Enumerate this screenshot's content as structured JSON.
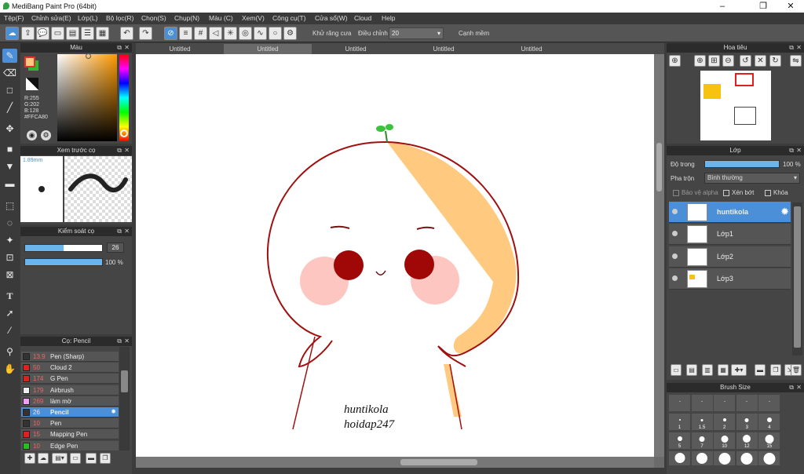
{
  "titlebar": {
    "title": "MediBang Paint Pro (64bit)",
    "minimize": "–",
    "maximize": "❐",
    "close": "✕"
  },
  "menu": [
    "Tệp(F)",
    "Chỉnh sửa(E)",
    "Lớp(L)",
    "Bộ lọc(R)",
    "Chọn(S)",
    "Chụp(N)",
    "Màu (C)",
    "Xem(V)",
    "Công cụ(T)",
    "Cửa sổ(W)",
    "Cloud",
    "Help"
  ],
  "toolbar": {
    "antialias_label": "Khử răng cưa",
    "adjust_label": "Điều chỉnh",
    "adjust_value": "20",
    "snap_label": "Cạnh mềm"
  },
  "colors": {
    "accent": "#4a8fd8",
    "primary": "#FFCA80",
    "secondary": "#2fb82f"
  },
  "color_panel": {
    "title": "Màu",
    "r": "R:255",
    "g": "G:202",
    "b": "B:128",
    "hex": "#FFCA80"
  },
  "brush_preview": {
    "title": "Xem trước cọ",
    "size": "1.89mm"
  },
  "brush_control": {
    "title": "Kiểm soát cọ",
    "size": "26",
    "opacity": "100 %",
    "size_fraction": 0.5,
    "opacity_fraction": 1.0
  },
  "brush_panel": {
    "title": "Cọ: Pencil",
    "items": [
      {
        "size": "13.9",
        "name": "Pen (Sharp)",
        "color": "#333333"
      },
      {
        "size": "50",
        "name": "Cloud 2",
        "color": "#e02020"
      },
      {
        "size": "174",
        "name": "G Pen",
        "color": "#e02020"
      },
      {
        "size": "179",
        "name": "Airbrush",
        "color": "#f0f0f0"
      },
      {
        "size": "269",
        "name": "làm mờ",
        "color": "#f0a0f0"
      },
      {
        "size": "26",
        "name": "Pencil",
        "color": "#333333",
        "selected": true
      },
      {
        "size": "10",
        "name": "Pen",
        "color": "#333333"
      },
      {
        "size": "15",
        "name": "Mapping Pen",
        "color": "#e02020"
      },
      {
        "size": "10",
        "name": "Edge Pen",
        "color": "#20c020"
      }
    ]
  },
  "tabs": [
    "Untitled",
    "Untitled",
    "Untitled",
    "Untitled",
    "Untitled"
  ],
  "canvas_text": {
    "line1": "huntikola",
    "line2": "hoidap247"
  },
  "navigator": {
    "title": "Hoa tiêu"
  },
  "layer_panel": {
    "title": "Lớp",
    "opacity_label": "Độ trong",
    "opacity_value": "100 %",
    "blend_label": "Pha trộn",
    "blend_value": "Bình thường",
    "protect_alpha": "Bảo vệ alpha",
    "clipping": "Xén bớt",
    "lock": "Khóa",
    "layers": [
      {
        "name": "huntikola",
        "selected": true
      },
      {
        "name": "Lớp1"
      },
      {
        "name": "Lớp2"
      },
      {
        "name": "Lớp3"
      }
    ]
  },
  "brush_size_panel": {
    "title": "Brush Size",
    "sizes": [
      "",
      "",
      "",
      "",
      "",
      "1",
      "1.5",
      "2",
      "3",
      "4",
      "5",
      "7",
      "10",
      "12",
      "15",
      "",
      "",
      "",
      "",
      ""
    ]
  }
}
